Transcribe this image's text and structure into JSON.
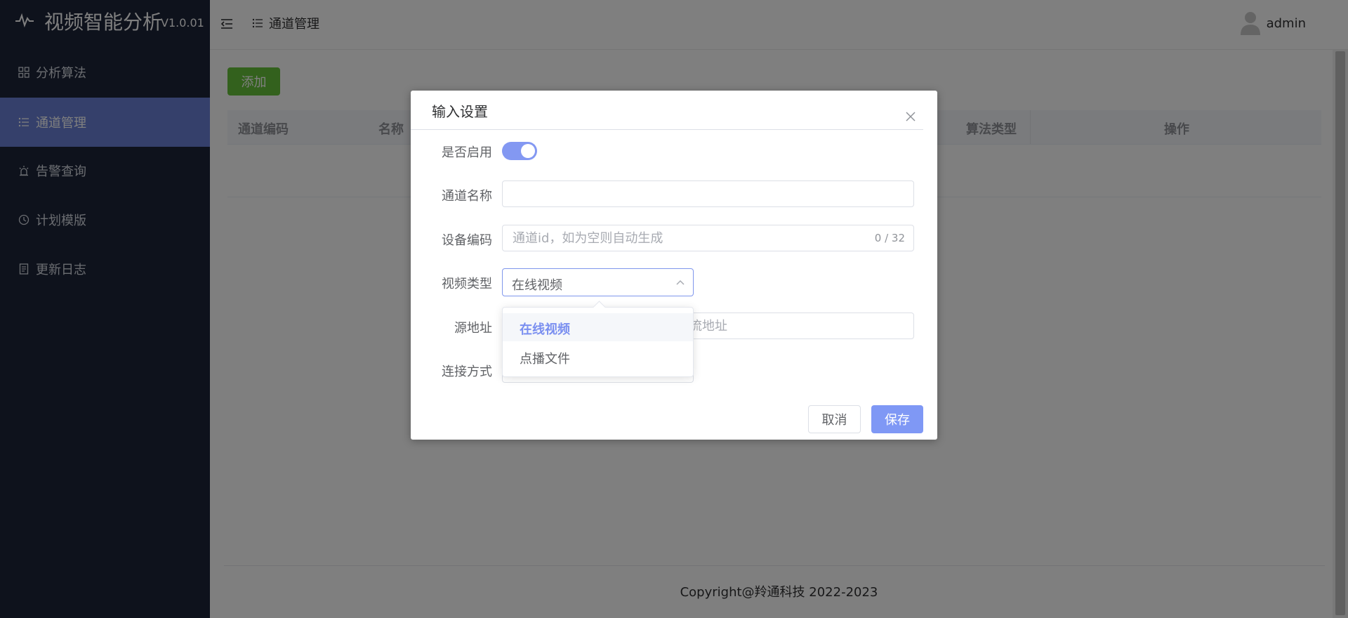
{
  "app": {
    "title": "视频智能分析",
    "version": "V1.0.01",
    "logo_icon": "pulse-icon"
  },
  "sidebar": {
    "items": [
      {
        "label": "分析算法",
        "icon": "grid-icon",
        "active": false
      },
      {
        "label": "通道管理",
        "icon": "list-icon",
        "active": true
      },
      {
        "label": "告警查询",
        "icon": "alarm-icon",
        "active": false
      },
      {
        "label": "计划模版",
        "icon": "clock-icon",
        "active": false
      },
      {
        "label": "更新日志",
        "icon": "document-icon",
        "active": false
      }
    ]
  },
  "header": {
    "breadcrumb": "通道管理",
    "user": "admin"
  },
  "main": {
    "add_button": "添加",
    "columns": [
      "通道编码",
      "名称",
      "算法类型",
      "操作"
    ],
    "copyright": "Copyright@羚通科技 2022-2023"
  },
  "dialog": {
    "title": "输入设置",
    "fields": {
      "enabled": {
        "label": "是否启用",
        "value": true
      },
      "channel_name": {
        "label": "通道名称",
        "value": "",
        "placeholder": ""
      },
      "device_code": {
        "label": "设备编码",
        "value": "",
        "placeholder": "通道id，如为空则自动生成",
        "counter": "0 / 32"
      },
      "video_type": {
        "label": "视频类型",
        "value": "在线视频",
        "options": [
          "在线视频",
          "点播文件"
        ]
      },
      "source": {
        "label": "源地址",
        "placeholder_visible": "流地址"
      },
      "connection": {
        "label": "连接方式"
      }
    },
    "cancel": "取消",
    "save": "保存"
  },
  "colors": {
    "sidebar_bg": "#1c2438",
    "sidebar_active": "#6a80d6",
    "accent": "#7f98f5",
    "add_green": "#67c23a"
  }
}
